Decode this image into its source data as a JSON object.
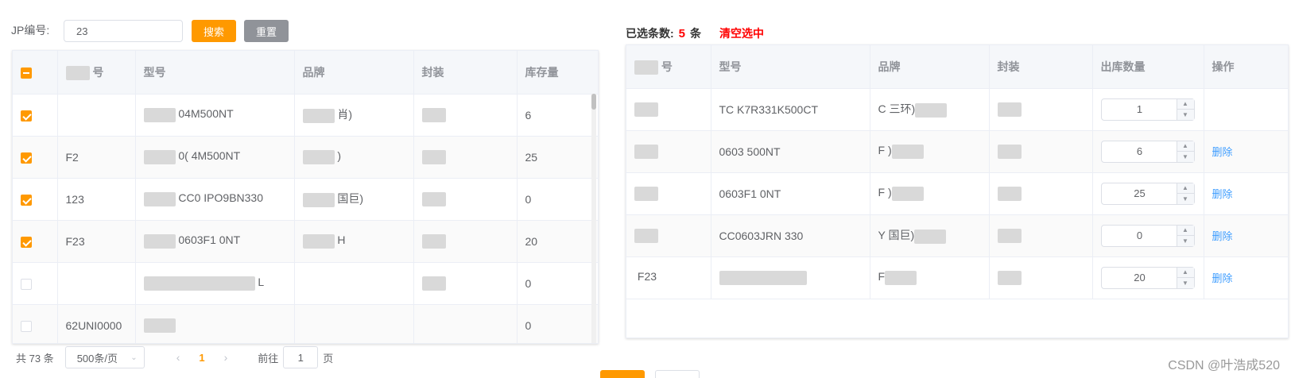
{
  "search": {
    "label": "JP编号:",
    "value": "23",
    "search_btn": "搜索",
    "reset_btn": "重置"
  },
  "selected": {
    "label": "已选条数:",
    "count": "5",
    "unit": "条",
    "clear": "清空选中"
  },
  "left_table": {
    "headers": [
      "",
      "号",
      "型号",
      "品牌",
      "封装",
      "库存量"
    ],
    "rows": [
      {
        "checked": true,
        "jp": "",
        "model": "04M500NT",
        "brand": "肖)",
        "stock": "6"
      },
      {
        "checked": true,
        "jp": "F2",
        "model": "0(        4M500NT",
        "brand": ")",
        "stock": "25"
      },
      {
        "checked": true,
        "jp": "123",
        "model": "CC0        IPO9BN330",
        "brand": "国巨)",
        "stock": "0"
      },
      {
        "checked": true,
        "jp": "F23",
        "model": "0603F1        0NT",
        "brand": "H",
        "stock": "20"
      },
      {
        "checked": false,
        "jp": "",
        "model": "L",
        "brand": "",
        "stock": "0"
      },
      {
        "checked": false,
        "jp": "62UNI0000",
        "model": "",
        "brand": "",
        "stock": "0"
      }
    ]
  },
  "right_table": {
    "headers": [
      "号",
      "型号",
      "品牌",
      "封装",
      "出库数量",
      "操作"
    ],
    "rows": [
      {
        "jp": "",
        "model": "TC        K7R331K500CT",
        "brand": "C    三环)",
        "qty": "1",
        "action": ""
      },
      {
        "jp": "",
        "model": "0603        500NT",
        "brand": "F      )",
        "qty": "6",
        "action": "删除"
      },
      {
        "jp": "",
        "model": "0603F1        0NT",
        "brand": "F      )",
        "qty": "25",
        "action": "删除"
      },
      {
        "jp": "",
        "model": "CC0603JRN        330",
        "brand": "Y      国巨)",
        "qty": "0",
        "action": "删除"
      },
      {
        "jp": "F23",
        "model": "",
        "brand": "F",
        "qty": "20",
        "action": "删除"
      }
    ]
  },
  "pagination": {
    "total": "共 73 条",
    "size": "500条/页",
    "current": "1",
    "goto": "前往",
    "jump": "1",
    "page": "页"
  },
  "watermark": "CSDN @叶浩成520"
}
